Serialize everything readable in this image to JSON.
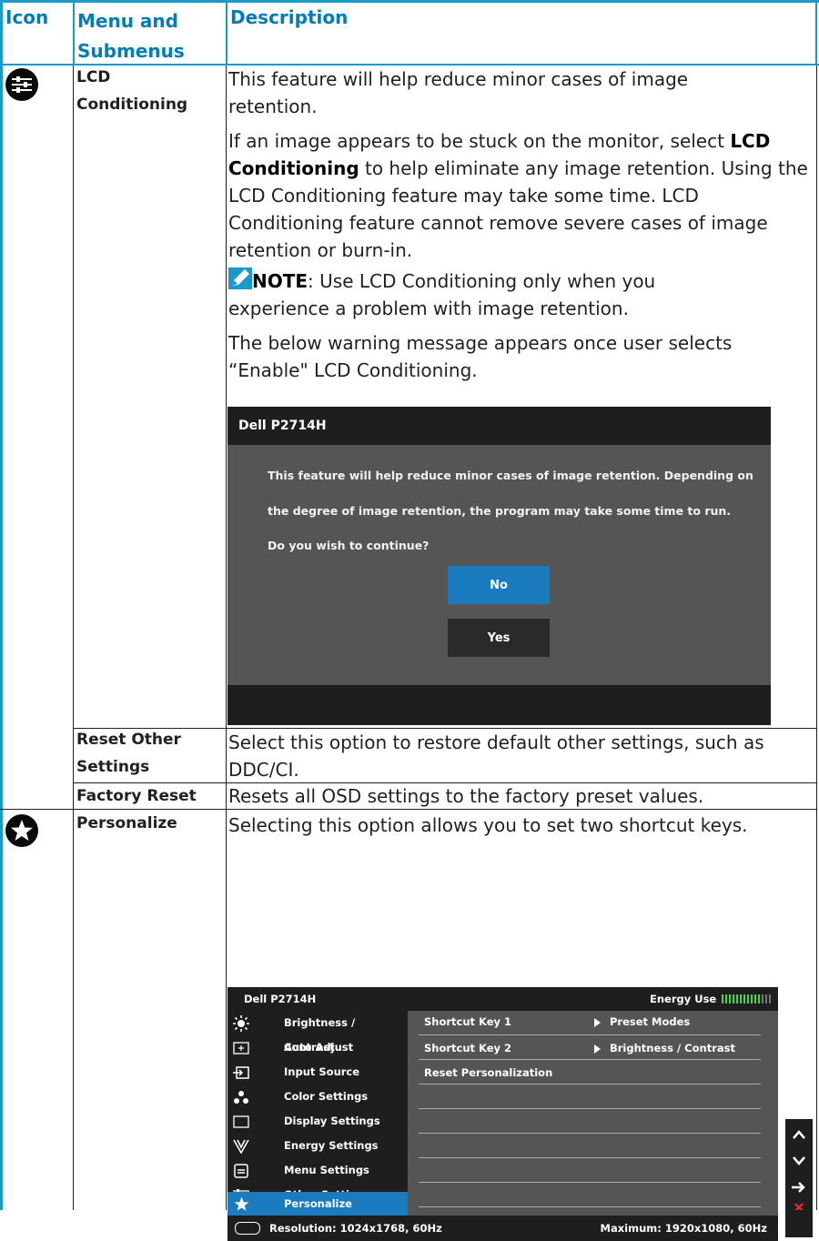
{
  "table": {
    "headers": {
      "icon": "Icon",
      "menu_line1": "Menu and",
      "menu_line2": "Submenus",
      "description": "Description"
    }
  },
  "rows": {
    "lcd": {
      "menu_line1": "LCD",
      "menu_line2": "Conditioning",
      "p1": "This feature will help reduce minor cases of image retention.",
      "p2_pre": "If an image appears to be stuck on the monitor, select",
      "p2_bold": "LCD Conditioning",
      "p2_post": " to help eliminate any image retention. Using the LCD Conditioning feature may take some time. LCD Conditioning feature cannot remove  severe cases of image retention or burn-in.",
      "note_label": "NOTE",
      "note_text": ": Use LCD Conditioning only when you experience a problem with image retention.",
      "p3": "The below warning message appears once user selects “Enable\" LCD Conditioning."
    },
    "reset_other": {
      "menu_line1": "Reset Other",
      "menu_line2": "Settings",
      "text": "Select this option to restore default other settings, such as DDC/CI."
    },
    "factory": {
      "menu": "Factory Reset",
      "text": "Resets all OSD settings to the factory preset values."
    },
    "personalize": {
      "menu": "Personalize",
      "text": "Selecting this option allows you to set two shortcut keys."
    }
  },
  "dialog": {
    "title": "Dell P2714H",
    "line1": "This feature will help reduce minor cases of image retention. Depending on",
    "line2": "the degree of image retention, the program may take some time to run.",
    "line3": "Do you wish to continue?",
    "no": "No",
    "yes": "Yes"
  },
  "osd": {
    "title": "Dell P2714H",
    "energy_label": "Energy Use",
    "energy_level": 0.8,
    "menu": [
      {
        "label": "Brightness / Contrast",
        "icon": "brightness-icon"
      },
      {
        "label": "Auto Adjust",
        "icon": "auto-adjust-icon"
      },
      {
        "label": "Input Source",
        "icon": "input-source-icon"
      },
      {
        "label": "Color Settings",
        "icon": "color-settings-icon"
      },
      {
        "label": "Display Settings",
        "icon": "display-settings-icon"
      },
      {
        "label": "Energy Settings",
        "icon": "energy-settings-icon"
      },
      {
        "label": "Menu Settings",
        "icon": "menu-settings-icon"
      },
      {
        "label": "Other Settings",
        "icon": "other-settings-icon"
      },
      {
        "label": "Personalize",
        "icon": "star-icon"
      }
    ],
    "rows": [
      {
        "label": "Shortcut Key 1",
        "value": "Preset Modes"
      },
      {
        "label": "Shortcut Key 2",
        "value": "Brightness / Contrast"
      },
      {
        "label": "Reset Personalization",
        "value": ""
      }
    ],
    "resolution": "Resolution: 1024x1768, 60Hz",
    "maximum": "Maximum: 1920x1080, 60Hz"
  },
  "colors": {
    "header_blue": "#007db8",
    "rule_blue": "#1a9ac9",
    "osd_select": "#1a7bbf",
    "close_red": "#e8262b"
  }
}
